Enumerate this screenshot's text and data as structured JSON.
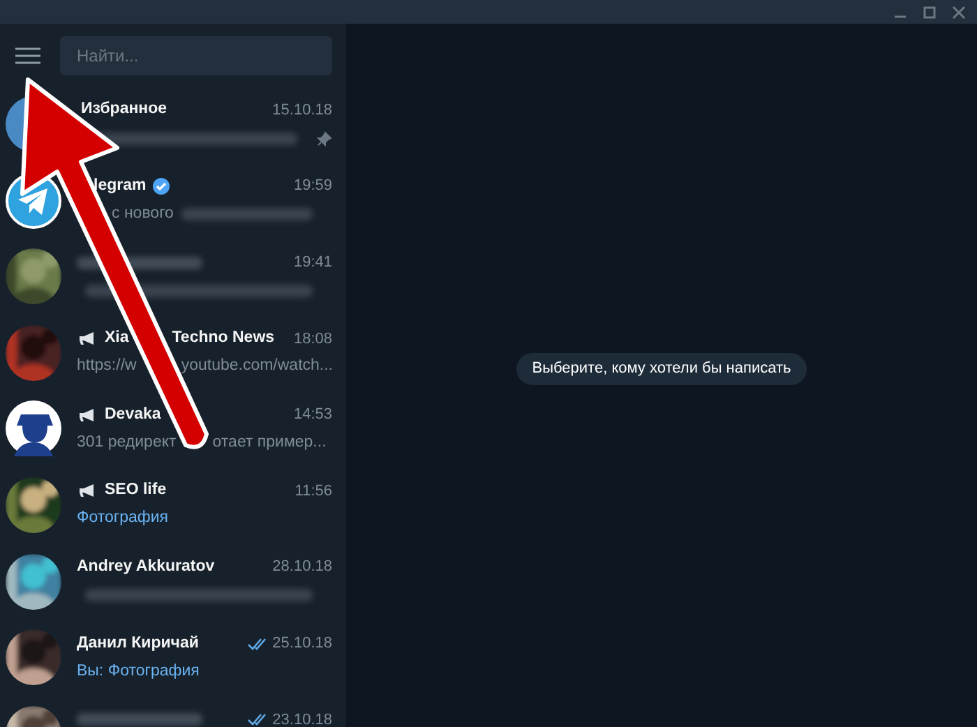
{
  "search": {
    "placeholder": "Найти..."
  },
  "chats": [
    {
      "avatar": {
        "kind": "saved"
      },
      "title": [
        {
          "kind": "text",
          "text": "Избранное"
        }
      ],
      "time": "15.10.18",
      "preview": [
        {
          "kind": "blurred"
        }
      ],
      "pinned": true
    },
    {
      "avatar": {
        "kind": "telegram"
      },
      "title": [
        {
          "kind": "text",
          "text": "legram"
        }
      ],
      "verified": true,
      "time": "19:59",
      "preview": [
        {
          "kind": "text",
          "text": "с нового"
        },
        {
          "kind": "blurred"
        }
      ]
    },
    {
      "avatar": {
        "kind": "picture"
      },
      "title": [
        {
          "kind": "blurred"
        }
      ],
      "time": "19:41",
      "preview": [
        {
          "kind": "blurred"
        }
      ]
    },
    {
      "avatar": {
        "kind": "picture"
      },
      "channel": true,
      "title": [
        {
          "kind": "text",
          "text": "Xia"
        },
        {
          "kind": "text",
          "text": "Techno News"
        }
      ],
      "time": "18:08",
      "preview": [
        {
          "kind": "text",
          "text": "https://w"
        },
        {
          "kind": "text",
          "text": "youtube.com/watch..."
        }
      ]
    },
    {
      "avatar": {
        "kind": "silhouette"
      },
      "channel": true,
      "title": [
        {
          "kind": "text",
          "text": "Devaka"
        }
      ],
      "time": "14:53",
      "preview": [
        {
          "kind": "text",
          "text": "301 редирект"
        },
        {
          "kind": "text",
          "text": "отает пример..."
        }
      ]
    },
    {
      "avatar": {
        "kind": "picture"
      },
      "channel": true,
      "title": [
        {
          "kind": "text",
          "text": "SEO life"
        }
      ],
      "time": "11:56",
      "preview": [
        {
          "kind": "media",
          "text": "Фотография"
        }
      ]
    },
    {
      "avatar": {
        "kind": "picture"
      },
      "title": [
        {
          "kind": "text",
          "text": "Andrey Akkuratov"
        }
      ],
      "time": "28.10.18",
      "preview": [
        {
          "kind": "blurred"
        }
      ]
    },
    {
      "avatar": {
        "kind": "picture"
      },
      "title": [
        {
          "kind": "text",
          "text": "Данил Киричай"
        }
      ],
      "read": true,
      "time": "25.10.18",
      "preview": [
        {
          "kind": "media",
          "text": "Вы: Фотография"
        }
      ]
    },
    {
      "avatar": {
        "kind": "picture"
      },
      "title": [
        {
          "kind": "blurred"
        }
      ],
      "read": true,
      "time": "23.10.18"
    }
  ],
  "empty_hint": "Выберите, кому хотели бы написать"
}
